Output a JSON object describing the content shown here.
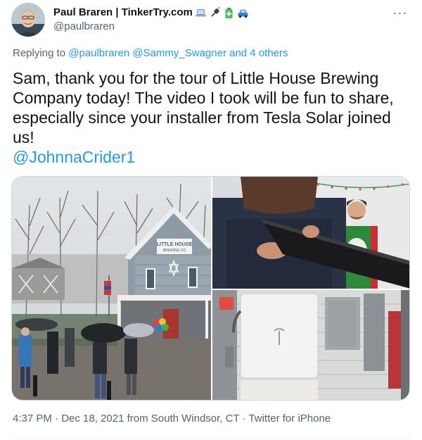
{
  "author": {
    "display_name": "Paul Braren | TinkerTry.com",
    "emoji_icons": [
      "laptop-icon",
      "plug-icon",
      "battery-icon",
      "car-icon"
    ],
    "handle": "@paulbraren"
  },
  "more_icon": "ellipsis-icon",
  "reply_context": {
    "prefix": "Replying to ",
    "mentions": "@paulbraren @Sammy_Swagner and 4 others"
  },
  "tweet": {
    "text": "Sam, thank you for the tour of Little House Brewing Company today! The video I took will be fun to share, especially since your installer from Tesla Solar joined us!",
    "mention": "@JohnnaCrider1"
  },
  "media": {
    "photos": [
      {
        "name": "brewery-exterior-photo",
        "sign_line1": "LITTLE HOUSE",
        "sign_line2": "BREWING CO"
      },
      {
        "name": "solar-panel-demo-photo"
      },
      {
        "name": "powerwall-battery-photo"
      }
    ]
  },
  "footer": {
    "meta": "4:37 PM · Dec 18, 2021 from South Windsor, CT · Twitter for iPhone"
  },
  "colors": {
    "link": "#1d9bf0",
    "secondary_text": "#536471",
    "primary_text": "#0f1419"
  }
}
